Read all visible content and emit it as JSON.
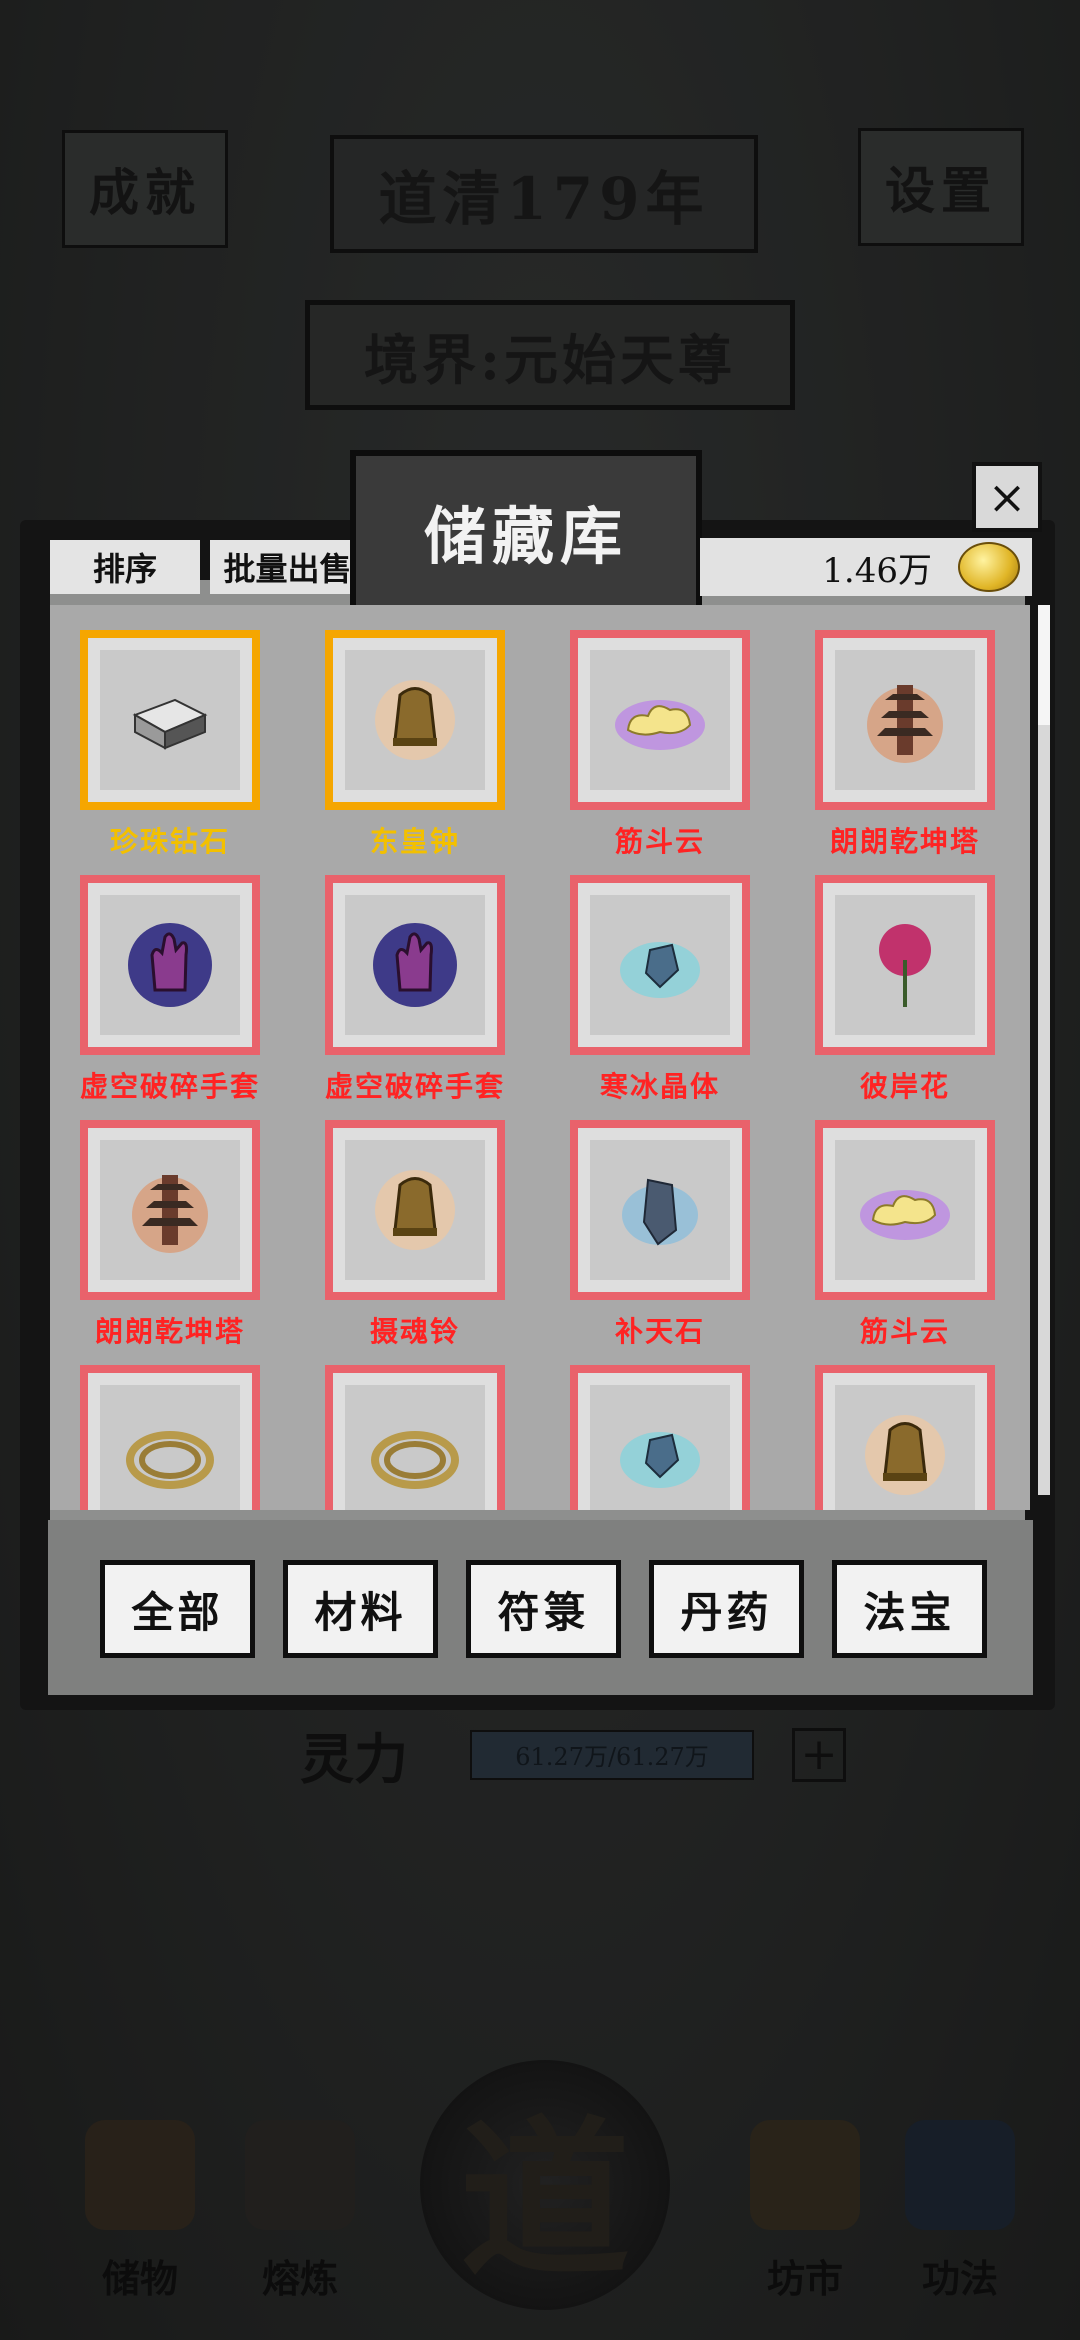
{
  "header": {
    "achievements_label": "成就",
    "year_label": "道清179年",
    "settings_label": "设置",
    "realm_label": "境界:元始天尊"
  },
  "spirit": {
    "label": "灵力",
    "value": "61.27万/61.27万",
    "plus": "+"
  },
  "storage": {
    "title": "储藏库",
    "close": "×",
    "sort_label": "排序",
    "bulk_sell_label": "批量出售",
    "coins": "1.46万",
    "items": [
      {
        "name": "珍珠钻石",
        "rarity": "gold",
        "icon": "diamond-icon"
      },
      {
        "name": "东皇钟",
        "rarity": "gold",
        "icon": "bell-icon"
      },
      {
        "name": "筋斗云",
        "rarity": "red",
        "icon": "cloud-icon"
      },
      {
        "name": "朗朗乾坤塔",
        "rarity": "red",
        "icon": "pagoda-icon"
      },
      {
        "name": "虚空破碎手套",
        "rarity": "red",
        "icon": "glove-icon"
      },
      {
        "name": "虚空破碎手套",
        "rarity": "red",
        "icon": "glove-icon"
      },
      {
        "name": "寒冰晶体",
        "rarity": "red",
        "icon": "crystal-icon"
      },
      {
        "name": "彼岸花",
        "rarity": "red",
        "icon": "flower-icon"
      },
      {
        "name": "朗朗乾坤塔",
        "rarity": "red",
        "icon": "pagoda-icon"
      },
      {
        "name": "摄魂铃",
        "rarity": "red",
        "icon": "bell-icon"
      },
      {
        "name": "补天石",
        "rarity": "red",
        "icon": "stone-icon"
      },
      {
        "name": "筋斗云",
        "rarity": "red",
        "icon": "cloud-icon"
      },
      {
        "name": "",
        "rarity": "red",
        "icon": "rope-icon"
      },
      {
        "name": "",
        "rarity": "red",
        "icon": "rope-icon"
      },
      {
        "name": "",
        "rarity": "red",
        "icon": "crystal-icon"
      },
      {
        "name": "",
        "rarity": "red",
        "icon": "bell-icon"
      }
    ],
    "categories": [
      "全部",
      "材料",
      "符箓",
      "丹药",
      "法宝"
    ]
  },
  "nav": {
    "storage": "储物",
    "smelt": "熔炼",
    "dao": "道",
    "market": "坊市",
    "skills": "功法"
  },
  "colors": {
    "gold_frame": "#f5a600",
    "red_frame": "#e9626b",
    "gold_text": "#f3c000",
    "red_text": "#ff2323"
  }
}
